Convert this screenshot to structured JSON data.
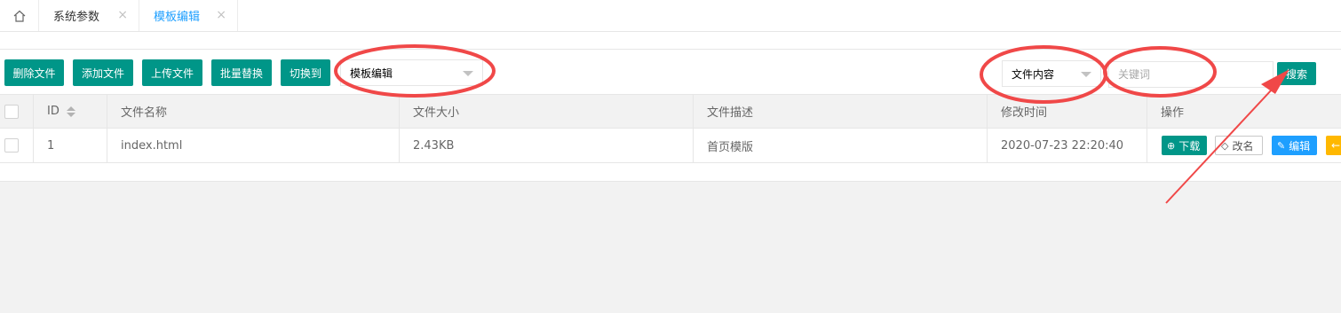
{
  "tabs": {
    "home_icon": "home-icon",
    "items": [
      {
        "label": "系统参数",
        "close": "×"
      },
      {
        "label": "模板编辑",
        "close": "×"
      }
    ]
  },
  "toolbar": {
    "buttons": [
      "删除文件",
      "添加文件",
      "上传文件",
      "批量替换",
      "切换到"
    ],
    "switch_select": "模板编辑",
    "search_field_select": "文件内容",
    "keyword_placeholder": "关键词",
    "search_label": "搜索"
  },
  "table": {
    "headers": [
      "ID",
      "文件名称",
      "文件大小",
      "文件描述",
      "修改时间",
      "操作"
    ],
    "rows": [
      {
        "id": "1",
        "name": "index.html",
        "size": "2.43KB",
        "desc": "首页模版",
        "mtime": "2020-07-23 22:20:40"
      }
    ],
    "actions": {
      "download": "下载",
      "rename": "改名",
      "edit": "编辑"
    }
  },
  "colors": {
    "primary": "#009688",
    "blue": "#1e9fff",
    "warn": "#ffb800",
    "annotation": "#f04848"
  }
}
